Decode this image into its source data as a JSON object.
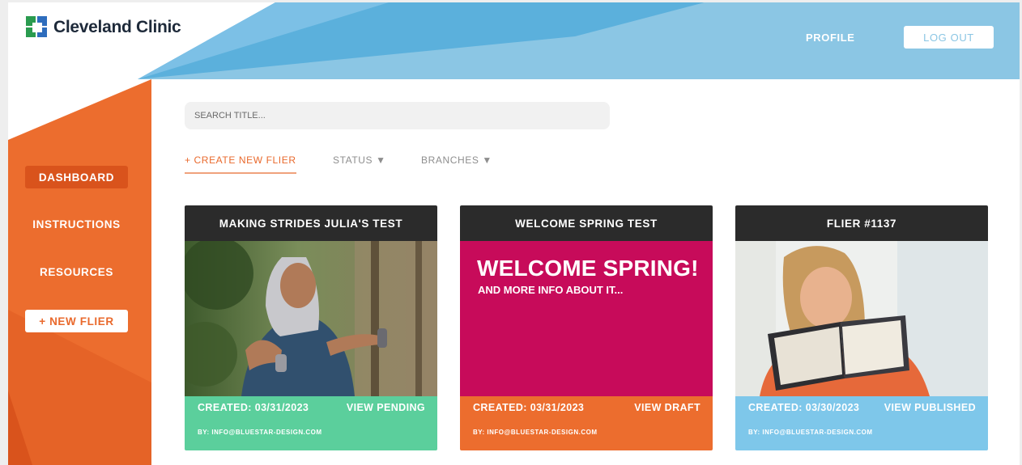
{
  "brand": {
    "name": "Cleveland Clinic"
  },
  "header": {
    "profile_label": "PROFILE",
    "logout_label": "LOG OUT"
  },
  "sidebar": {
    "items": [
      {
        "label": "DASHBOARD",
        "active": true
      },
      {
        "label": "INSTRUCTIONS",
        "active": false
      },
      {
        "label": "RESOURCES",
        "active": false
      }
    ],
    "new_flier_label": "+ NEW FLIER"
  },
  "search": {
    "placeholder": "SEARCH TITLE..."
  },
  "filters": {
    "create_label": "+ CREATE NEW FLIER",
    "status_label": "STATUS ▼",
    "branches_label": "BRANCHES ▼"
  },
  "cards": [
    {
      "title": "MAKING STRIDES JULIA'S TEST",
      "created": "CREATED: 03/31/2023",
      "action": "VIEW PENDING",
      "by": "BY: INFO@BLUESTAR-DESIGN.COM"
    },
    {
      "title": "WELCOME SPRING TEST",
      "created": "CREATED: 03/31/2023",
      "action": "VIEW DRAFT",
      "by": "BY: INFO@BLUESTAR-DESIGN.COM",
      "image_title": "WELCOME SPRING!",
      "image_subtitle": "AND MORE INFO ABOUT IT..."
    },
    {
      "title": "FLIER #1137",
      "created": "CREATED: 03/30/2023",
      "action": "VIEW PUBLISHED",
      "by": "BY: INFO@BLUESTAR-DESIGN.COM"
    }
  ],
  "colors": {
    "orange": "#ec6d2e",
    "orange_dark": "#d9531c",
    "sky_blue": "#8bc6e4",
    "blue": "#5bb0dc",
    "card_header": "#2b2b2b",
    "pending_green": "#5bcf9c",
    "draft_orange": "#ec6d2e",
    "published_blue": "#7ec7ea",
    "magenta": "#c70b5a"
  }
}
